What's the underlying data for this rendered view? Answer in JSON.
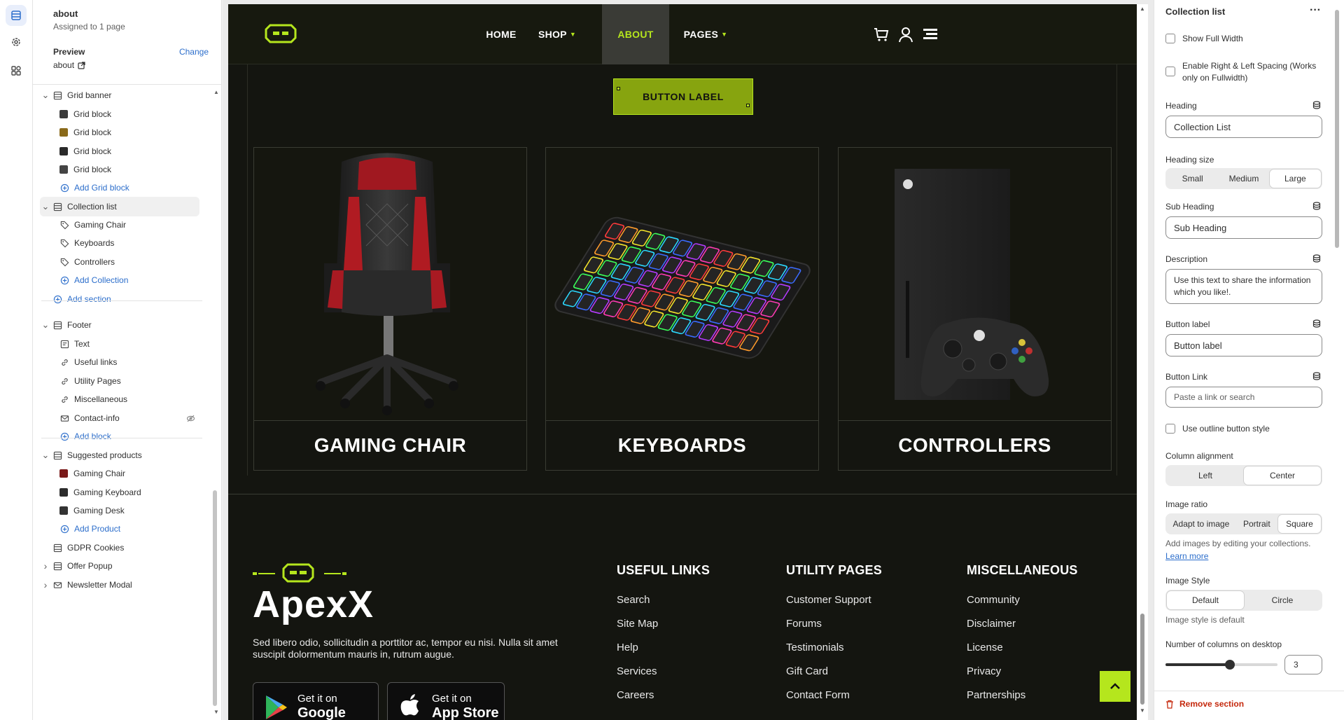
{
  "sidebar": {
    "page_title": "about",
    "page_subtitle": "Assigned to 1 page",
    "preview_label": "Preview",
    "change_label": "Change",
    "preview_page": "about",
    "tree": [
      {
        "label": "Grid banner",
        "level": 0,
        "kind": "section",
        "caret": "down"
      },
      {
        "label": "Grid block",
        "level": 1,
        "kind": "thumb",
        "thumb": "#3a3a3a"
      },
      {
        "label": "Grid block",
        "level": 1,
        "kind": "thumb",
        "thumb": "#8a6a1a"
      },
      {
        "label": "Grid block",
        "level": 1,
        "kind": "thumb",
        "thumb": "#2a2a2a"
      },
      {
        "label": "Grid block",
        "level": 1,
        "kind": "thumb",
        "thumb": "#444444"
      },
      {
        "label": "Add Grid block",
        "level": 1,
        "kind": "add"
      },
      {
        "label": "Collection list",
        "level": 0,
        "kind": "section",
        "caret": "down",
        "selected": true
      },
      {
        "label": "Gaming Chair",
        "level": 1,
        "kind": "tag"
      },
      {
        "label": "Keyboards",
        "level": 1,
        "kind": "tag"
      },
      {
        "label": "Controllers",
        "level": 1,
        "kind": "tag"
      },
      {
        "label": "Add Collection",
        "level": 1,
        "kind": "add"
      },
      {
        "label": "Add section",
        "level": 0,
        "kind": "add"
      },
      {
        "label": "Footer",
        "level": 0,
        "kind": "section",
        "caret": "down"
      },
      {
        "label": "Text",
        "level": 1,
        "kind": "text"
      },
      {
        "label": "Useful links",
        "level": 1,
        "kind": "link"
      },
      {
        "label": "Utility Pages",
        "level": 1,
        "kind": "link"
      },
      {
        "label": "Miscellaneous",
        "level": 1,
        "kind": "link"
      },
      {
        "label": "Contact-info",
        "level": 1,
        "kind": "mail",
        "hidden": true
      },
      {
        "label": "Add block",
        "level": 1,
        "kind": "add"
      },
      {
        "label": "Suggested products",
        "level": 0,
        "kind": "section",
        "caret": "down"
      },
      {
        "label": "Gaming Chair",
        "level": 1,
        "kind": "thumb",
        "thumb": "#7a1a1a"
      },
      {
        "label": "Gaming Keyboard",
        "level": 1,
        "kind": "thumb",
        "thumb": "#2c2c2c"
      },
      {
        "label": "Gaming Desk",
        "level": 1,
        "kind": "thumb",
        "thumb": "#333333"
      },
      {
        "label": "Add Product",
        "level": 1,
        "kind": "add"
      },
      {
        "label": "GDPR Cookies",
        "level": 0,
        "kind": "section"
      },
      {
        "label": "Offer Popup",
        "level": 0,
        "kind": "section",
        "caret": "right"
      },
      {
        "label": "Newsletter Modal",
        "level": 0,
        "kind": "mailsection",
        "caret": "right"
      }
    ]
  },
  "preview": {
    "nav": [
      "HOME",
      "SHOP",
      "ABOUT",
      "PAGES"
    ],
    "button_label": "BUTTON LABEL",
    "collections": [
      "GAMING CHAIR",
      "KEYBOARDS",
      "CONTROLLERS"
    ],
    "brand": "ApexX",
    "footer_desc": "Sed libero odio, sollicitudin a porttitor ac, tempor eu nisi. Nulla sit amet suscipit dolormentum mauris in, rutrum augue.",
    "stores": [
      {
        "small": "Get it on",
        "big": "Google Play"
      },
      {
        "small": "Get it on",
        "big": "App Store"
      }
    ],
    "columns": [
      {
        "title": "USEFUL LINKS",
        "items": [
          "Search",
          "Site Map",
          "Help",
          "Services",
          "Careers"
        ]
      },
      {
        "title": "UTILITY PAGES",
        "items": [
          "Customer Support",
          "Forums",
          "Testimonials",
          "Gift Card",
          "Contact Form"
        ]
      },
      {
        "title": "MISCELLANEOUS",
        "items": [
          "Community",
          "Disclaimer",
          "License",
          "Privacy",
          "Partnerships"
        ]
      }
    ],
    "accent": "#b5e61d"
  },
  "settings": {
    "title": "Collection list",
    "show_full_width": "Show Full Width",
    "enable_spacing": "Enable Right & Left Spacing (Works only on Fullwidth)",
    "heading_label": "Heading",
    "heading_value": "Collection List",
    "heading_size_label": "Heading size",
    "heading_sizes": [
      "Small",
      "Medium",
      "Large"
    ],
    "sub_heading_label": "Sub Heading",
    "sub_heading_value": "Sub Heading",
    "description_label": "Description",
    "description_value": "Use this text to share the information which you like!.",
    "button_label_label": "Button label",
    "button_label_value": "Button label",
    "button_link_label": "Button Link",
    "button_link_placeholder": "Paste a link or search",
    "outline_label": "Use outline button style",
    "column_alignment_label": "Column alignment",
    "column_alignments": [
      "Left",
      "Center"
    ],
    "image_ratio_label": "Image ratio",
    "image_ratios": [
      "Adapt to image",
      "Portrait",
      "Square"
    ],
    "image_hint": "Add images by editing your collections.",
    "learn_more": "Learn more",
    "image_style_label": "Image Style",
    "image_styles": [
      "Default",
      "Circle"
    ],
    "image_style_hint": "Image style is default",
    "columns_label": "Number of columns on desktop",
    "columns_value": "3",
    "remove_section": "Remove section"
  }
}
